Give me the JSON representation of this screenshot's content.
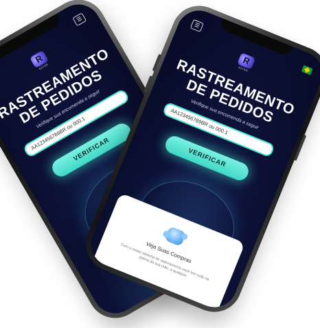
{
  "app": {
    "title": "RASTREAMENTO\nDE PEDIDOS",
    "subtitle": "Verifique sua encomenda a seguir",
    "logo_text": "ASTER",
    "menu_icon": "☰",
    "language_flag": "brazil-flag-icon"
  },
  "search": {
    "value_back": "AA123456789BR ou 000.1",
    "value_front": "AA123456789BR ou 000.1"
  },
  "verify_button": {
    "label": "VERIFICAR"
  },
  "feature_card": {
    "icon": "cloud-shopping-icon",
    "title": "Veja Suas Compras",
    "text": "Com o nosso sistema de rastreamento você tem tudo na palma da sua mão, a qualquer"
  },
  "colors": {
    "background_dark": "#0d1238",
    "accent_cyan": "#40d8c6",
    "card_bg": "#ffffff"
  }
}
